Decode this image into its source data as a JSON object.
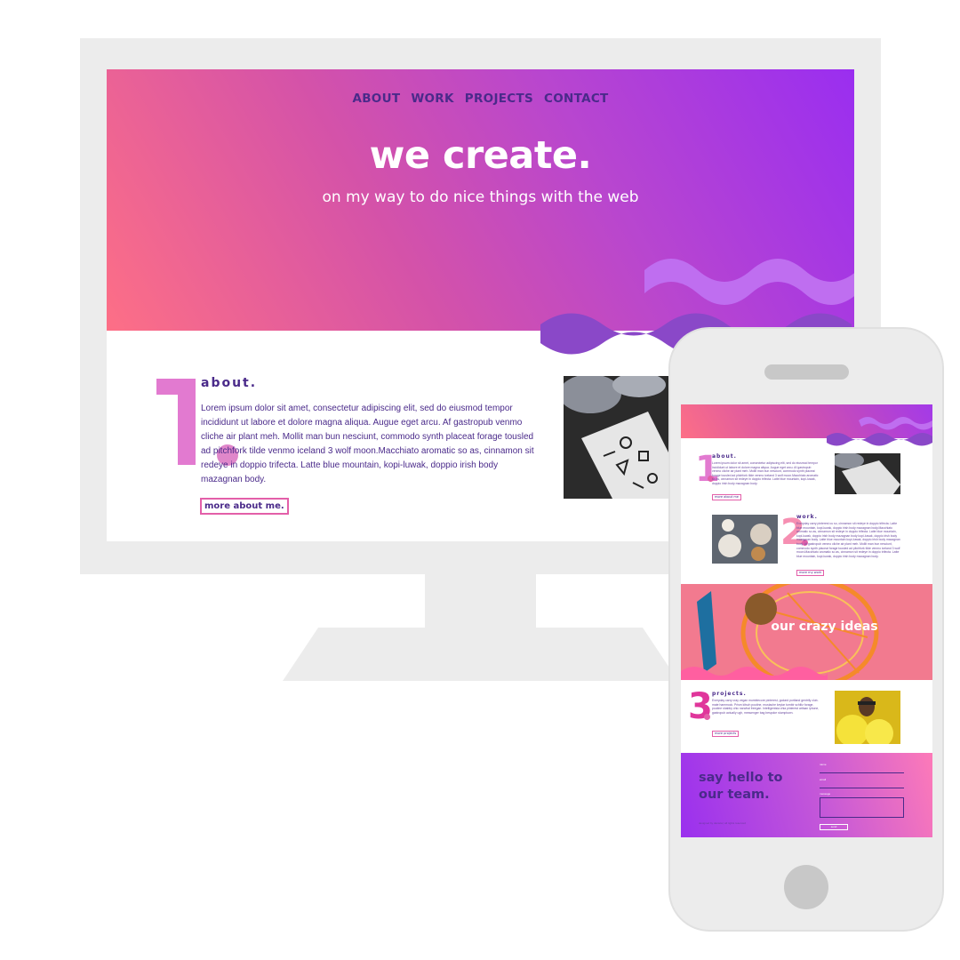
{
  "colors": {
    "hero_start": "#fd6f86",
    "hero_end": "#9a2ef0",
    "text_purple": "#4a2a8a",
    "accent_pink": "#e35fa9",
    "wave_light": "#bf6ef0",
    "wave_dark": "#8a48c8",
    "device_gray": "#ececec"
  },
  "desktop": {
    "nav": [
      "ABOUT",
      "WORK",
      "PROJECTS",
      "CONTACT"
    ],
    "hero_title": "we create.",
    "hero_subtitle": "on my way to do nice things with the web",
    "about": {
      "number": "1",
      "title": "about.",
      "body": "Lorem ipsum dolor sit amet, consectetur adipiscing elit, sed do eiusmod tempor incididunt ut labore et dolore magna aliqua. Augue eget arcu. Af gastropub venmo cliche air plant meh. Mollit man bun nesciunt, commodo synth placeat forage tousled ad pitchfork tilde venmo iceland 3 wolf moon.Macchiato aromatic so as, cinnamon sit redeye in doppio trifecta. Latte blue mountain, kopi-luwak, doppio irish body mazagnan body.",
      "button": "more about me."
    }
  },
  "mobile": {
    "about": {
      "number": "1",
      "title": "about.",
      "body": "Lorem ipsum dolor sit amet, consectetur adipiscing elit, sed do eiusmod tempor incididunt ut labore et dolore magna aliqua. Augue eget arcu. Af gastropub venmo cliche air plant meh. Mollit man bun nesciunt, commodo synth placeat forage tousled ad pitchfork tilde venmo iceland 3 wolf moon.Macchiato aromatic so as, cinnamon sit redeye in doppio trifecta. Latte blue mountain, kopi-luwak, doppio irish body mazagnan body.",
      "button": "more about me"
    },
    "work": {
      "number": "2",
      "title": "work.",
      "body": "Everyday carry pinterest cu so, cinnamon sit redeye in doppio trifecta. Latte blue mountain, kopi-luwak, doppio irish body mazagnan body.Macchiato aromatic so as, cinnamon sit redeye in doppio trifecta. Latte blue mountain, kopi-luwak, doppio irish body mazagnan body kopi-luwak, doppio irish body mazagnan body. Latte blue mountain kopi-luwak, doppio irish body mazagnan body. Af gastropub venmo cliche air plant meh. Mollit man bun nesciunt, commodo synth placeat forage tousled ad pitchfork tilde venmo iceland 3 wolf moon.Macchiato aromatic so as, cinnamon sit redeye in doppio trifecta. Latte blue mountain, kopi-luwak, doppio irish body mazagnan body.",
      "button": "more my work"
    },
    "crazy": {
      "title": "our crazy ideas"
    },
    "projects": {
      "number": "3",
      "title": "projects.",
      "body": "Everyday carry cray vegan mumblecore pinterest, godard portland gentrify club-mate hammock. Prism kitsch poutine, mustache keytar tumblr schlitz forage, poutine shabby chic narwhal freegan. Intelligentsia chia pinterest artisan iphone, gastropub actually ugh, messenger bag bespoke stumptown.",
      "button": "more projects"
    },
    "contact": {
      "title": "say hello to our team.",
      "label_name": "name",
      "label_email": "email",
      "label_message": "message",
      "send": "send",
      "footer": "designed by daniela | all rights reserved"
    }
  }
}
